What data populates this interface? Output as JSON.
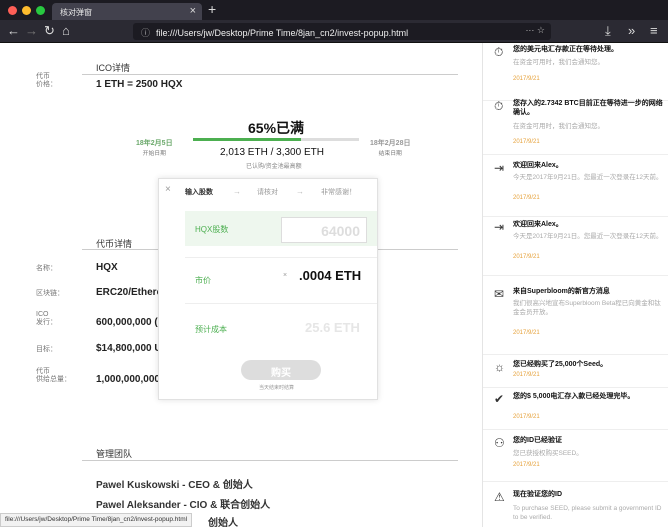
{
  "browser": {
    "tab_title": "核对弹窗",
    "tab_close": "×",
    "new_tab": "+",
    "url": "file:///Users/jw/Desktop/Prime Time/8jan_cn2/invest-popup.html",
    "url_icons": "··· ☆",
    "status_url": "file:///Users/jw/Desktop/Prime Time/8jan_cn2/invest-popup.html"
  },
  "colors": {
    "accent_green": "#4caf50",
    "notif_date": "#e6a23c"
  },
  "ico": {
    "section_title": "ICO详情",
    "price_label": "代币\n价格：",
    "price_value": "1 ETH = 2500 HQX",
    "percent_full": "65%已满",
    "progress_fraction": 0.65,
    "start_date": "18年2月5日",
    "start_label": "开始日期",
    "end_date": "18年2月28日",
    "end_label": "结束日期",
    "raised": "2,013 ETH / 3,300 ETH",
    "raised_sub": "已认购/资金池最高额"
  },
  "token": {
    "section_title": "代币详情",
    "rows": [
      {
        "label": "名称：",
        "value": "HQX"
      },
      {
        "label": "区块链：",
        "value": "ERC20/Ethereum"
      },
      {
        "label": "ICO\n发行：",
        "value": "600,000,000 ("
      },
      {
        "label": "目标：",
        "value": "$14,800,000 U"
      },
      {
        "label": "代币\n供给总量：",
        "value": "1,000,000,000"
      }
    ]
  },
  "team": {
    "section_title": "管理团队",
    "members": [
      "Pawel Kuskowski - CEO & 创始人",
      "Pawel Aleksander - CIO & 联合创始人",
      "创始人"
    ]
  },
  "popup": {
    "close": "×",
    "steps": [
      "输入股数",
      "请核对",
      "非常感谢！"
    ],
    "arrow": "→",
    "shares_label": "HQX股数",
    "shares_placeholder": "64000",
    "price_label": "市价",
    "price_x": "×",
    "price_value": ".0004 ETH",
    "cost_label": "预计成本",
    "cost_value": "25.6 ETH",
    "buy_button": "购买",
    "buy_note": "当天结束时结算"
  },
  "notifications": [
    {
      "icon": "stopwatch-icon",
      "glyph": "⏱",
      "title": "您的美元电汇存款正在等待处理。",
      "body": "在资金可用时，我们会通知您。",
      "date": "2017/9/21"
    },
    {
      "icon": "stopwatch-icon",
      "glyph": "⏱",
      "title": "您存入的2.7342 BTC目前正在等待进一步的网络确认。",
      "body": "在资金可用时，我们会通知您。",
      "date": "2017/9/21"
    },
    {
      "icon": "login-icon",
      "glyph": "⇥",
      "title": "欢迎回来Alex。",
      "body": "今天是2017年9月21日。您最近一次登录在12天前。",
      "date": "2017/9/21"
    },
    {
      "icon": "login-icon",
      "glyph": "⇥",
      "title": "欢迎回来Alex。",
      "body": "今天是2017年9月21日。您最近一次登录在12天前。",
      "date": "2017/9/21"
    },
    {
      "icon": "mail-icon",
      "glyph": "✉",
      "title": "来自Superbloom的新官方消息",
      "body": "我们很高兴地宣布Superbloom Beta程已向黄金和钛金会员开放。",
      "date": "2017/9/21"
    },
    {
      "icon": "sun-icon",
      "glyph": "☼",
      "title": "您已经购买了25,000个Seed。",
      "body": "",
      "date": "2017/9/21"
    },
    {
      "icon": "check-circle-icon",
      "glyph": "✔",
      "title": "您的$ 5,000电汇存入款已经处理完毕。",
      "body": "",
      "date": "2017/9/21"
    },
    {
      "icon": "user-check-icon",
      "glyph": "⚇",
      "title": "您的ID已经验证",
      "body": "您已获授权购买SEED。",
      "date": "2017/9/21"
    },
    {
      "icon": "warning-icon",
      "glyph": "⚠",
      "title": "现在验证您的ID",
      "body": "To purchase SEED, please submit a government ID to be verified.",
      "date": ""
    }
  ]
}
